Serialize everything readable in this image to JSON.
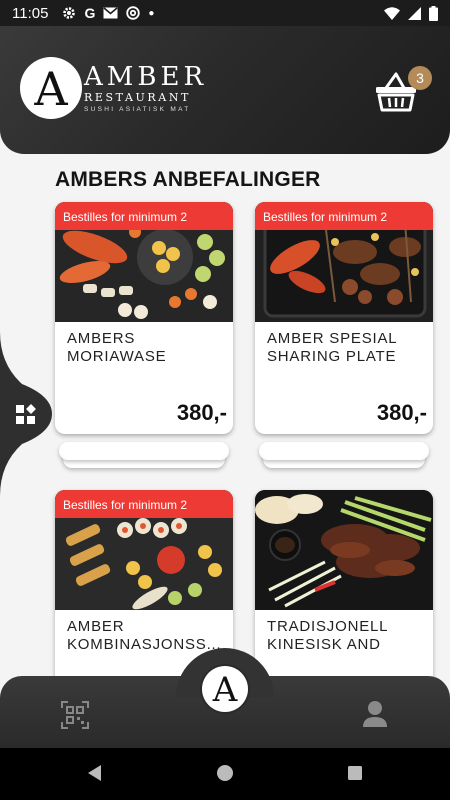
{
  "status_bar": {
    "time": "11:05",
    "left_icons": [
      "gear-icon",
      "google-icon",
      "gmail-icon",
      "at-sign-icon",
      "dot-icon"
    ],
    "right_icons": [
      "wifi-icon",
      "signal-icon",
      "battery-icon"
    ]
  },
  "header": {
    "logo_letter": "A",
    "brand": "AMBER",
    "subtitle": "RESTAURANT",
    "tagline": "SUSHI ASIATISK MAT",
    "cart_count": "3"
  },
  "section": {
    "title": "AMBERS ANBEFALINGER"
  },
  "products": [
    {
      "badge": "Bestilles for minimum 2",
      "name": "AMBERS MORIAWASE",
      "price": "380,-",
      "image": "sushi-platter"
    },
    {
      "badge": "Bestilles for minimum 2",
      "name": "AMBER SPESIAL SHARING PLATE",
      "price": "380,-",
      "image": "grill-plate"
    },
    {
      "badge": "Bestilles for minimum 2",
      "name": "AMBER KOMBINASJONSS...",
      "price": "",
      "image": "combination-platter"
    },
    {
      "badge": "",
      "name": "TRADISJONELL KINESISK AND",
      "price": "",
      "image": "peking-duck"
    }
  ],
  "bottom_nav": {
    "center_letter": "A",
    "items": [
      "qr-scan-icon",
      "profile-icon"
    ]
  },
  "colors": {
    "badge_red": "#ee3a34",
    "cart_badge": "#b48a58",
    "header_dark": "#2a2a2a"
  }
}
